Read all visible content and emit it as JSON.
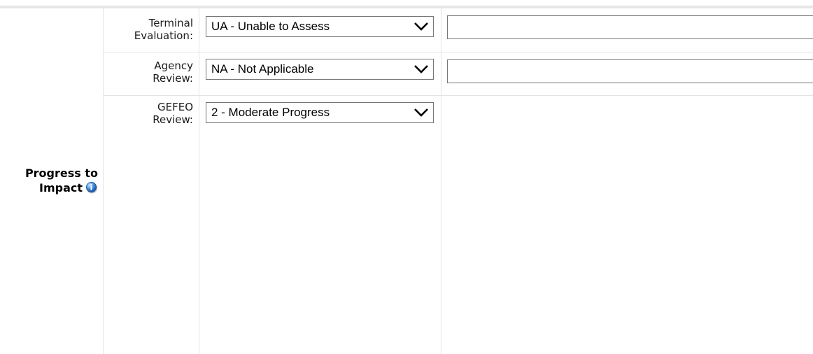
{
  "section": {
    "title_line1": "Progress to",
    "title_line2": "Impact",
    "info_icon": "info-icon"
  },
  "rows": [
    {
      "label_line1": "Terminal",
      "label_line2": "Evaluation:",
      "selected": "UA - Unable to Assess",
      "comment": ""
    },
    {
      "label_line1": "Agency",
      "label_line2": "Review:",
      "selected": "NA - Not Applicable",
      "comment": ""
    },
    {
      "label_line1": "GEFEO",
      "label_line2": "Review:",
      "selected": "2 - Moderate Progress"
    }
  ]
}
